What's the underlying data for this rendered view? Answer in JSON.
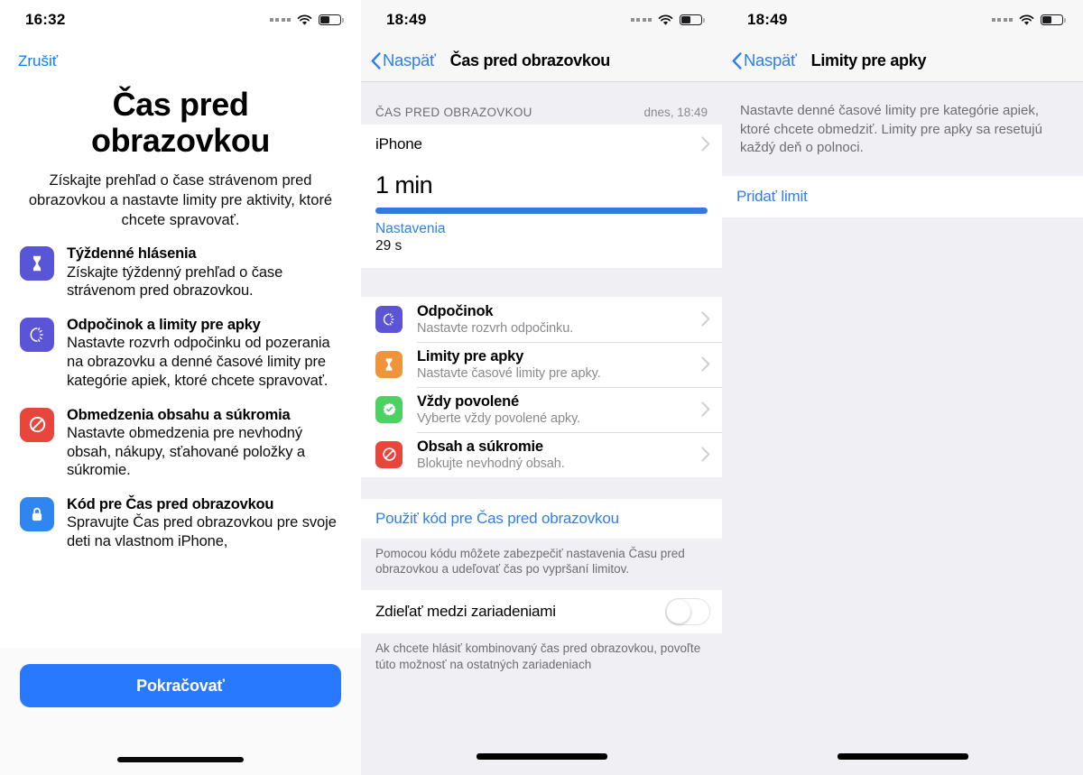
{
  "colors": {
    "accent_blue": "#2d7ff0",
    "cta_blue": "#2979ff",
    "progress_blue": "#3479e0",
    "group_bg": "#efeff4",
    "icon_purple": "#5856d6",
    "icon_indigo": "#5b54d6",
    "icon_orange": "#f0943b",
    "icon_green": "#4cd162",
    "icon_red": "#e8453c",
    "icon_blue": "#2f86f0"
  },
  "panel1": {
    "status": {
      "time": "16:32",
      "signal": "signal-dots-icon",
      "wifi": "wifi-icon",
      "battery": "battery-icon"
    },
    "cancel_label": "Zrušiť",
    "title": "Čas pred obrazovkou",
    "subtitle": "Získajte prehľad o čase strávenom pred obrazovkou a nastavte limity pre aktivity, ktoré chcete spravovať.",
    "features": [
      {
        "icon": "hourglass-icon",
        "icon_bg": "#5856d6",
        "title": "Týždenné hlásenia",
        "desc": "Získajte týždenný prehľad o čase strávenom pred obrazovkou."
      },
      {
        "icon": "downtime-moon-icon",
        "icon_bg": "#5b54d6",
        "title": "Odpočinok a limity pre apky",
        "desc": "Nastavte rozvrh odpočinku od pozerania na obrazovku a denné časové limity pre kategórie apiek, ktoré chcete spravovať."
      },
      {
        "icon": "prohibited-icon",
        "icon_bg": "#e8453c",
        "title": "Obmedzenia obsahu a súkromia",
        "desc": "Nastavte obmedzenia pre nevhodný obsah, nákupy, sťahované položky a súkromie."
      },
      {
        "icon": "lock-icon",
        "icon_bg": "#2f86f0",
        "title": "Kód pre Čas pred obrazovkou",
        "desc": "Spravujte Čas pred obrazovkou pre svoje deti na vlastnom iPhone,"
      }
    ],
    "continue_label": "Pokračovať"
  },
  "panel2": {
    "status": {
      "time": "18:49"
    },
    "nav": {
      "back_label": "Naspäť",
      "title": "Čas pred obrazovkou"
    },
    "section_header": {
      "left": "ČAS PRED OBRAZOVKOU",
      "right": "dnes, 18:49"
    },
    "device_cell": {
      "label": "iPhone"
    },
    "usage": {
      "total": "1 min",
      "progress_percent": 100,
      "app_name": "Nastavenia",
      "app_duration": "29 s"
    },
    "menu": [
      {
        "icon": "downtime-moon-icon",
        "icon_bg": "#5b54d6",
        "title": "Odpočinok",
        "sub": "Nastavte rozvrh odpočinku."
      },
      {
        "icon": "hourglass-icon",
        "icon_bg": "#f0943b",
        "title": "Limity pre apky",
        "sub": "Nastavte časové limity pre apky."
      },
      {
        "icon": "always-allowed-check-icon",
        "icon_bg": "#4cd162",
        "title": "Vždy povolené",
        "sub": "Vyberte vždy povolené apky."
      },
      {
        "icon": "prohibited-icon",
        "icon_bg": "#e8453c",
        "title": "Obsah a súkromie",
        "sub": "Blokujte nevhodný obsah."
      }
    ],
    "passcode_link": "Použiť kód pre Čas pred obrazovkou",
    "passcode_note": "Pomocou kódu môžete zabezpečiť nastavenia Času pred obrazovkou a udeľovať čas po vypršaní limitov.",
    "share_row": {
      "label": "Zdieľať medzi zariadeniami",
      "toggle_on": false
    },
    "share_note": "Ak chcete hlásiť kombinovaný čas pred obrazovkou, povoľte túto možnosť na ostatných zariadeniach"
  },
  "panel3": {
    "status": {
      "time": "18:49"
    },
    "nav": {
      "back_label": "Naspäť",
      "title": "Limity pre apky"
    },
    "intro": "Nastavte denné časové limity pre kategórie apiek, ktoré chcete obmedziť. Limity pre apky sa resetujú každý deň o polnoci.",
    "add_limit_label": "Pridať limit"
  }
}
